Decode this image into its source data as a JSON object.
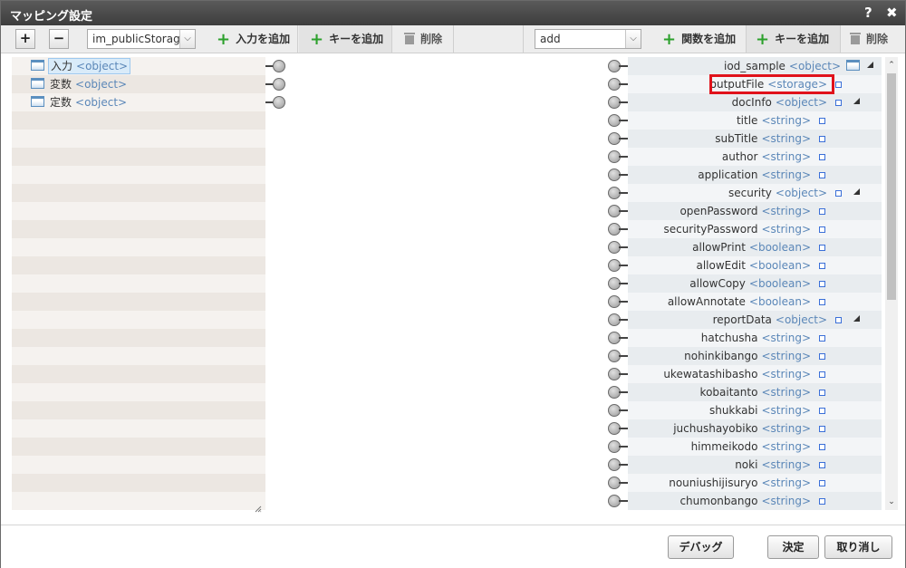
{
  "window": {
    "title": "マッピング設定",
    "help_label": "?",
    "close_label": "✖"
  },
  "toolbar": {
    "expand_label": "+",
    "collapse_label": "−",
    "source_select_value": "im_publicStorage",
    "left_add_input_label": "入力を追加",
    "left_add_key_label": "キーを追加",
    "left_delete_label": "削除",
    "function_select_value": "add",
    "add_function_label": "関数を追加",
    "right_add_key_label": "キーを追加",
    "right_delete_label": "削除"
  },
  "left_tree": [
    {
      "name": "入力",
      "type": "<object>"
    },
    {
      "name": "変数",
      "type": "<object>"
    },
    {
      "name": "定数",
      "type": "<object>"
    }
  ],
  "right_tree": [
    {
      "name": "iod_sample",
      "type": "<object>"
    },
    {
      "name": "outputFile",
      "type": "<storage>"
    },
    {
      "name": "docInfo",
      "type": "<object>"
    },
    {
      "name": "title",
      "type": "<string>"
    },
    {
      "name": "subTitle",
      "type": "<string>"
    },
    {
      "name": "author",
      "type": "<string>"
    },
    {
      "name": "application",
      "type": "<string>"
    },
    {
      "name": "security",
      "type": "<object>"
    },
    {
      "name": "openPassword",
      "type": "<string>"
    },
    {
      "name": "securityPassword",
      "type": "<string>"
    },
    {
      "name": "allowPrint",
      "type": "<boolean>"
    },
    {
      "name": "allowEdit",
      "type": "<boolean>"
    },
    {
      "name": "allowCopy",
      "type": "<boolean>"
    },
    {
      "name": "allowAnnotate",
      "type": "<boolean>"
    },
    {
      "name": "reportData",
      "type": "<object>"
    },
    {
      "name": "hatchusha",
      "type": "<string>"
    },
    {
      "name": "nohinkibango",
      "type": "<string>"
    },
    {
      "name": "ukewatashibasho",
      "type": "<string>"
    },
    {
      "name": "kobaitanto",
      "type": "<string>"
    },
    {
      "name": "shukkabi",
      "type": "<string>"
    },
    {
      "name": "juchushayobiko",
      "type": "<string>"
    },
    {
      "name": "himmeikodo",
      "type": "<string>"
    },
    {
      "name": "noki",
      "type": "<string>"
    },
    {
      "name": "nouniushijisuryo",
      "type": "<string>"
    },
    {
      "name": "chumonbango",
      "type": "<string>"
    }
  ],
  "footer": {
    "debug_label": "デバッグ",
    "ok_label": "決定",
    "cancel_label": "取り消し"
  },
  "colors": {
    "highlight": "#e0121b",
    "type_text": "#5b87b8",
    "add_icon": "#2ca02c"
  }
}
